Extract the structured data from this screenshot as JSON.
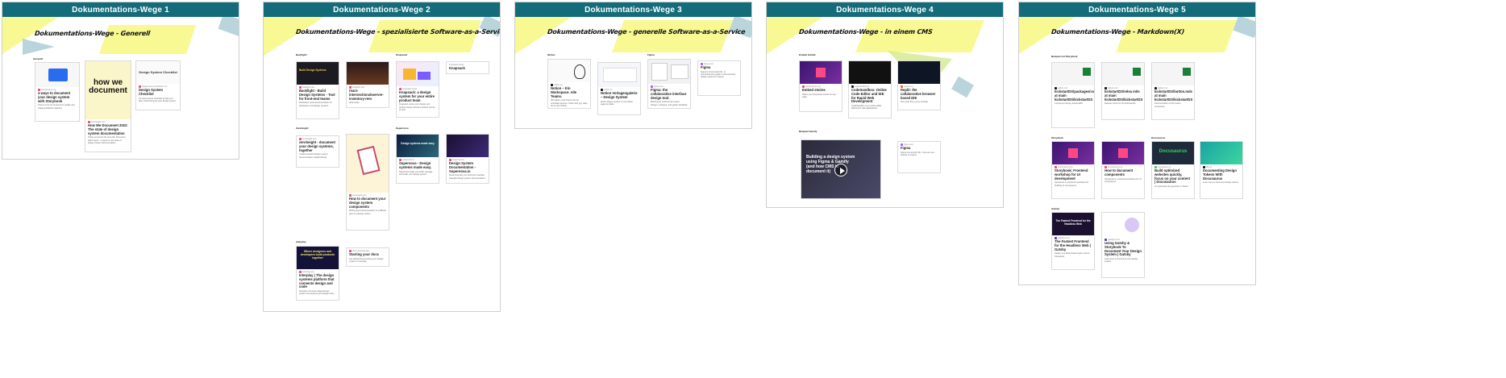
{
  "frames": [
    {
      "header": "Dokumentations-Wege 1",
      "title": "Dokumentations-Wege - Generell",
      "sections": [
        "Generell"
      ],
      "cards": [
        {
          "title": "4 ways to document your design system with Storybook",
          "desc": "There's a lot of components’ quality and usage guidelines together",
          "src": "storybook.js.org"
        },
        {
          "title": "How We Document 2022: The state of design system documentation",
          "desc": "Today we launch the How We Document 2022 report - a report on the state of design system documentation",
          "src": "zeroheight.com",
          "thumb": "how we document"
        },
        {
          "title": "Design System Checklist",
          "desc": "An open-source checklist to help you plan, build and grow your design system",
          "src": "designsystemchecklist.com",
          "thumb": "Design System Checklist"
        }
      ]
    },
    {
      "header": "Dokumentations-Wege 2",
      "title": "Dokumentations-Wege - spezialisierte Software-as-a-Service",
      "sections": [
        "Backlight",
        "Knapsack",
        "Zeroheight",
        "Supernova",
        "Interplay"
      ],
      "cards": [
        {
          "title": "Backlight - Build Design Systems - Tool for front-end teams",
          "desc": "Dedicated, quick documentation for developers and design systems",
          "src": "backlight.dev",
          "thumb": "Build Design Systems"
        },
        {
          "title": "react-intersectionobserver-inventory-rem",
          "desc": "Web mode",
          "src": "backlight.dev"
        },
        {
          "title": "Knapsack: a design system for your entire product team",
          "desc": "Knapsack unites your design and product teams around a shared source of truth",
          "src": "knapsack.cloud"
        },
        {
          "title": "Knapsack",
          "desc": "",
          "src": "knapsack.cloud"
        },
        {
          "title": "zeroheight - document your design systems, together",
          "desc": "Create beautiful design system documentation collaboratively",
          "src": "zeroheight.com"
        },
        {
          "title": "How to document your design system components",
          "desc": "Writing good documentation is a difficult part of a design system",
          "src": "zeroheight.com"
        },
        {
          "title": "Supernova - Design systems made easy.",
          "desc": "Supernova helps you build, manage and scale your design system",
          "src": "supernova.io",
          "thumb": "Design systems made easy"
        },
        {
          "title": "Design System Documentation - Supernova.io",
          "desc": "Supernova lets you build and maintain beautiful design system documentation",
          "src": "supernova.io"
        },
        {
          "title": "Interplay | The design systems platform that connects design and code",
          "desc": "Interplay connects coded design system components with design tools",
          "src": "interplay.app",
          "thumb": "Where designers and developers build products together"
        },
        {
          "title": "Starting your docs",
          "desc": "Get started documenting your design system in Interplay",
          "src": "docs.interplay.app"
        }
      ]
    },
    {
      "header": "Dokumentations-Wege 3",
      "title": "Dokumentations-Wege - generelle Software-as-a-Service",
      "sections": [
        "Notion",
        "Figma"
      ],
      "cards": [
        {
          "title": "Notion – Ein Workspace. Alle Teams.",
          "desc": "Wir haben mehr Nutzer als wir verkraften können. Fühle dich gut, dass du es hier findest.",
          "src": "notion.so"
        },
        {
          "title": "Notion Vorlagengalerie – Design System",
          "desc": "Entire design system in one Notion page template",
          "src": "notion.so"
        },
        {
          "title": "Figma: the collaborative interface design tool.",
          "desc": "Build better products as a team. Design, prototype, and gather feedback",
          "src": "figma.com"
        },
        {
          "title": "Figma",
          "desc": "Figma's Community file - A comprehensive guide to documenting design systems in Figma",
          "src": "figma.com"
        }
      ]
    },
    {
      "header": "Dokumentations-Wege 4",
      "title": "Dokumentations-Wege - in einem CMS",
      "sections": [
        "Embed Inhalte",
        "Beispiel Gamify"
      ],
      "cards": [
        {
          "title": "Embed stories",
          "desc": "Share your Storybook stories on any page",
          "src": "storybook.js.org"
        },
        {
          "title": "CodeSandbox: Online Code Editor and IDE for Rapid Web Development",
          "desc": "CodeSandbox is an online editor tailored for web applications",
          "src": "codesandbox.io"
        },
        {
          "title": "Replit: the collaborative browser based IDE",
          "desc": "Run code live in your browser",
          "src": "replit.com"
        },
        {
          "title": "Figma",
          "desc": "Figma Community file - How we use Gamify on Figma",
          "src": "figma.com"
        }
      ],
      "video": {
        "title": "Building a design system using Figma & Gamify (and how CMS to document it)"
      }
    },
    {
      "header": "Dokumentations-Wege 5",
      "title": "Dokumentations-Wege - Markdown(X)",
      "sections": [
        "Beispiel mit Storybook",
        "Storybook",
        "Docusaurus",
        "Gatsby"
      ],
      "cards": [
        {
          "title": "kickstartDS/packages/components/docs at main kickstartDS/kickstartDS",
          "desc": "Component library kickstartDS",
          "src": "github.com"
        },
        {
          "title": "kickstartDS/relea mits at main kickstartDS/kickstartDS",
          "desc": "Release notes for the kickstartDS",
          "src": "github.com"
        },
        {
          "title": "kickstartDS/button.mdx at main kickstartDS/kickstartDS",
          "desc": "Documentation of the button component",
          "src": "github.com"
        },
        {
          "title": "Storybook: Frontend workshop for UI development",
          "desc": "Storybook is a frontend workshop for building UI components",
          "src": "storybook.js.org"
        },
        {
          "title": "How to document components",
          "desc": "Storybook is a frontend workshop for UI components",
          "src": "storybook.js.org"
        },
        {
          "title": "Build optimized websites quickly, focus on your content | Docusaurus",
          "desc": "An optimized site generator in React",
          "src": "docusaurus.io",
          "thumb": "Docusaurus"
        },
        {
          "title": "Documenting Design Tokens With Docusaurus",
          "desc": "Learn how to document design tokens",
          "src": "dev.to"
        },
        {
          "title": "The Fastest Frontend for the Headless Web | Gatsby",
          "desc": "Gatsby is a React-based open source framework",
          "src": "gatsbyjs.com",
          "thumb": "The Fastest Frontend for the Headless Web"
        },
        {
          "title": "Using Gatsby & Storybook To Document Your Design System | Gatsby",
          "desc": "Learn how to document your design system",
          "src": "gatsbyjs.com"
        }
      ]
    }
  ]
}
